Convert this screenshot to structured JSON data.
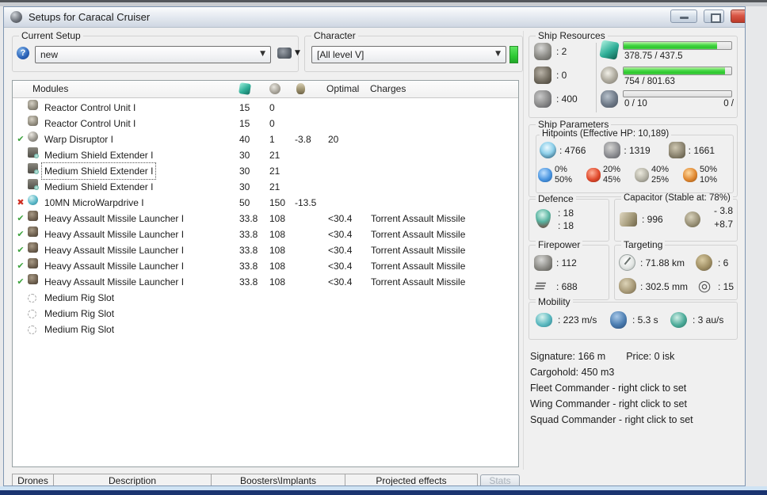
{
  "window": {
    "title": "Setups for Caracal Cruiser"
  },
  "icons": {
    "help_glyph": "?",
    "caret_glyph": "▼",
    "status_ok_glyph": "✔",
    "status_error_glyph": "✖",
    "dps_glyph": "≡",
    "sensor_glyph": "◎"
  },
  "colors": {
    "bar_green": "#2cc42c",
    "char_bar_green": "#2ec933",
    "check_green": "#3da33d",
    "error_red": "#cf2f23",
    "navy_strip": "#1b3470"
  },
  "setup": {
    "label": "Current Setup",
    "value": "new"
  },
  "character": {
    "label": "Character",
    "value": "[All level V]"
  },
  "modules": {
    "header": {
      "name": "Modules",
      "optimal": "Optimal",
      "charges": "Charges"
    },
    "rows": [
      {
        "status": "",
        "icon": "reactor-control",
        "name": "Reactor Control Unit I",
        "cpu": "15",
        "pg": "0",
        "cap": "",
        "optimal": "",
        "charges": "",
        "focused": false
      },
      {
        "status": "",
        "icon": "reactor-control",
        "name": "Reactor Control Unit I",
        "cpu": "15",
        "pg": "0",
        "cap": "",
        "optimal": "",
        "charges": "",
        "focused": false
      },
      {
        "status": "ok",
        "icon": "warp-disruptor",
        "name": "Warp Disruptor I",
        "cpu": "40",
        "pg": "1",
        "cap": "-3.8",
        "optimal": "20",
        "charges": "",
        "focused": false
      },
      {
        "status": "",
        "icon": "shield-extender",
        "name": "Medium Shield Extender I",
        "cpu": "30",
        "pg": "21",
        "cap": "",
        "optimal": "",
        "charges": "",
        "focused": false
      },
      {
        "status": "",
        "icon": "shield-extender",
        "name": "Medium Shield Extender I",
        "cpu": "30",
        "pg": "21",
        "cap": "",
        "optimal": "",
        "charges": "",
        "focused": true
      },
      {
        "status": "",
        "icon": "shield-extender",
        "name": "Medium Shield Extender I",
        "cpu": "30",
        "pg": "21",
        "cap": "",
        "optimal": "",
        "charges": "",
        "focused": false
      },
      {
        "status": "error",
        "icon": "microwarpdrive",
        "name": "10MN MicroWarpdrive I",
        "cpu": "50",
        "pg": "150",
        "cap": "-13.5",
        "optimal": "",
        "charges": "",
        "focused": false
      },
      {
        "status": "ok",
        "icon": "missile-launcher",
        "name": "Heavy Assault Missile Launcher I",
        "cpu": "33.8",
        "pg": "108",
        "cap": "",
        "optimal": "<30.4",
        "charges": "Torrent Assault Missile",
        "focused": false
      },
      {
        "status": "ok",
        "icon": "missile-launcher",
        "name": "Heavy Assault Missile Launcher I",
        "cpu": "33.8",
        "pg": "108",
        "cap": "",
        "optimal": "<30.4",
        "charges": "Torrent Assault Missile",
        "focused": false
      },
      {
        "status": "ok",
        "icon": "missile-launcher",
        "name": "Heavy Assault Missile Launcher I",
        "cpu": "33.8",
        "pg": "108",
        "cap": "",
        "optimal": "<30.4",
        "charges": "Torrent Assault Missile",
        "focused": false
      },
      {
        "status": "ok",
        "icon": "missile-launcher",
        "name": "Heavy Assault Missile Launcher I",
        "cpu": "33.8",
        "pg": "108",
        "cap": "",
        "optimal": "<30.4",
        "charges": "Torrent Assault Missile",
        "focused": false
      },
      {
        "status": "ok",
        "icon": "missile-launcher",
        "name": "Heavy Assault Missile Launcher I",
        "cpu": "33.8",
        "pg": "108",
        "cap": "",
        "optimal": "<30.4",
        "charges": "Torrent Assault Missile",
        "focused": false
      },
      {
        "status": "",
        "icon": "rig-slot",
        "name": "Medium Rig Slot",
        "cpu": "",
        "pg": "",
        "cap": "",
        "optimal": "",
        "charges": "",
        "focused": false
      },
      {
        "status": "",
        "icon": "rig-slot",
        "name": "Medium Rig Slot",
        "cpu": "",
        "pg": "",
        "cap": "",
        "optimal": "",
        "charges": "",
        "focused": false
      },
      {
        "status": "",
        "icon": "rig-slot",
        "name": "Medium Rig Slot",
        "cpu": "",
        "pg": "",
        "cap": "",
        "optimal": "",
        "charges": "",
        "focused": false
      }
    ]
  },
  "tabs": [
    {
      "label": "Drones"
    },
    {
      "label": "Description"
    },
    {
      "label": "Boosters\\Implants"
    },
    {
      "label": "Projected effects"
    }
  ],
  "stats_button": "Stats",
  "resources": {
    "label": "Ship Resources",
    "turrets": ": 2",
    "launchers": ": 0",
    "calibration": ": 400",
    "cpu": {
      "text": "378.75 / 437.5",
      "pct": 86.6
    },
    "powergrid": {
      "text": "754 / 801.63",
      "pct": 94
    },
    "drones": {
      "left": "0 / 10",
      "right": "0 /",
      "pct": 0
    }
  },
  "parameters": {
    "label": "Ship Parameters",
    "hitpoints": {
      "label": "Hitpoints (Effective HP: 10,189)",
      "shield": ": 4766",
      "armor": ": 1319",
      "structure": ": 1661",
      "resists": [
        [
          "0%",
          "50%"
        ],
        [
          "20%",
          "45%"
        ],
        [
          "40%",
          "25%"
        ],
        [
          "50%",
          "10%"
        ]
      ]
    }
  },
  "defence": {
    "label": "Defence",
    "v1": ": 18",
    "v2": ": 18"
  },
  "capacitor": {
    "label": "Capacitor (Stable at: 78%)",
    "amount": ": 996",
    "minus": "- 3.8",
    "plus": "+8.7"
  },
  "firepower": {
    "label": "Firepower",
    "volley": ": 112",
    "dps": ": 688"
  },
  "targeting": {
    "label": "Targeting",
    "range": ": 71.88 km",
    "targets": ": 6",
    "scan": ": 302.5 mm",
    "sensor": ": 15"
  },
  "mobility": {
    "label": "Mobility",
    "speed": ": 223 m/s",
    "align": ": 5.3 s",
    "warp": ": 3 au/s"
  },
  "info": {
    "signature": "Signature: 166 m",
    "price": "Price: 0 isk",
    "cargo": "Cargohold: 450 m3",
    "fleet": "Fleet Commander - right click to set",
    "wing": "Wing Commander - right click to set",
    "squad": "Squad Commander - right click to set"
  }
}
